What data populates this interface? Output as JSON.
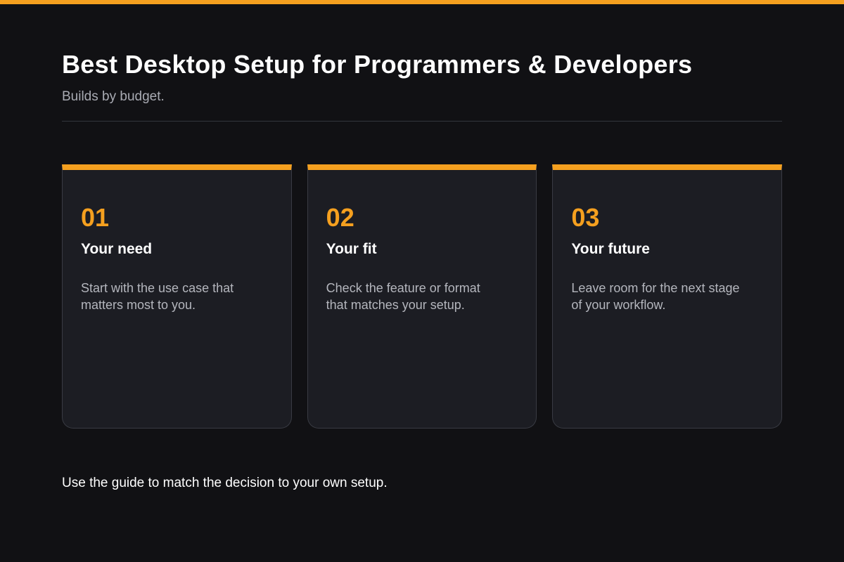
{
  "theme": {
    "accent": "#f5a01f",
    "background": "#111114",
    "card_background": "#1c1d23"
  },
  "header": {
    "title": "Best Desktop Setup for Programmers & Developers",
    "subtitle": "Builds by budget."
  },
  "cards": [
    {
      "number": "01",
      "title": "Your need",
      "description": "Start with the use case that matters most to you."
    },
    {
      "number": "02",
      "title": "Your fit",
      "description": "Check the feature or format that matches your setup."
    },
    {
      "number": "03",
      "title": "Your future",
      "description": "Leave room for the next stage of your workflow."
    }
  ],
  "footer": {
    "text": "Use the guide to match the decision to your own setup."
  }
}
